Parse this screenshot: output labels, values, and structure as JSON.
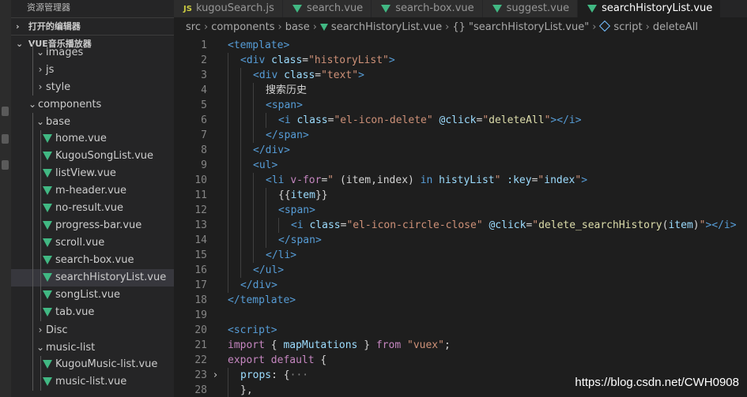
{
  "sidebar": {
    "title": "资源管理器",
    "open_editors_label": "打开的编辑器",
    "project_label": "VUE音乐播放器",
    "tree": [
      {
        "label": "images",
        "kind": "folder",
        "expanded": true,
        "depth": 2
      },
      {
        "label": "js",
        "kind": "folder",
        "expanded": false,
        "depth": 2
      },
      {
        "label": "style",
        "kind": "folder",
        "expanded": false,
        "depth": 2
      },
      {
        "label": "components",
        "kind": "folder",
        "expanded": true,
        "depth": 1
      },
      {
        "label": "base",
        "kind": "folder",
        "expanded": true,
        "depth": 2
      },
      {
        "label": "home.vue",
        "kind": "vue",
        "depth": 3
      },
      {
        "label": "KugouSongList.vue",
        "kind": "vue",
        "depth": 3
      },
      {
        "label": "listView.vue",
        "kind": "vue",
        "depth": 3
      },
      {
        "label": "m-header.vue",
        "kind": "vue",
        "depth": 3
      },
      {
        "label": "no-result.vue",
        "kind": "vue",
        "depth": 3
      },
      {
        "label": "progress-bar.vue",
        "kind": "vue",
        "depth": 3
      },
      {
        "label": "scroll.vue",
        "kind": "vue",
        "depth": 3
      },
      {
        "label": "search-box.vue",
        "kind": "vue",
        "depth": 3
      },
      {
        "label": "searchHistoryList.vue",
        "kind": "vue",
        "depth": 3,
        "selected": true
      },
      {
        "label": "songList.vue",
        "kind": "vue",
        "depth": 3
      },
      {
        "label": "tab.vue",
        "kind": "vue",
        "depth": 3
      },
      {
        "label": "Disc",
        "kind": "folder",
        "expanded": false,
        "depth": 2
      },
      {
        "label": "music-list",
        "kind": "folder",
        "expanded": true,
        "depth": 2
      },
      {
        "label": "KugouMusic-list.vue",
        "kind": "vue",
        "depth": 3
      },
      {
        "label": "music-list.vue",
        "kind": "vue",
        "depth": 3
      }
    ]
  },
  "tabs": [
    {
      "label": "kugouSearch.js",
      "icon": "js",
      "active": false
    },
    {
      "label": "search.vue",
      "icon": "vue",
      "active": false
    },
    {
      "label": "search-box.vue",
      "icon": "vue",
      "active": false
    },
    {
      "label": "suggest.vue",
      "icon": "vue",
      "active": false
    },
    {
      "label": "searchHistoryList.vue",
      "icon": "vue",
      "active": true
    }
  ],
  "breadcrumb": [
    "src",
    "components",
    "base",
    "searchHistoryList.vue",
    "{} \"searchHistoryList.vue\"",
    "script",
    "deleteAll"
  ],
  "code": [
    {
      "n": "1",
      "indent": 0,
      "tokens": [
        [
          "tag",
          "<template>"
        ]
      ]
    },
    {
      "n": "2",
      "indent": 1,
      "tokens": [
        [
          "tag",
          "<div "
        ],
        [
          "attr",
          "class"
        ],
        [
          "txt",
          "="
        ],
        [
          "str",
          "\"historyList\""
        ],
        [
          "tag",
          ">"
        ]
      ]
    },
    {
      "n": "3",
      "indent": 2,
      "tokens": [
        [
          "tag",
          "<div "
        ],
        [
          "attr",
          "class"
        ],
        [
          "txt",
          "="
        ],
        [
          "str",
          "\"text\""
        ],
        [
          "tag",
          ">"
        ]
      ]
    },
    {
      "n": "4",
      "indent": 3,
      "tokens": [
        [
          "cjk",
          "搜索历史"
        ]
      ]
    },
    {
      "n": "5",
      "indent": 3,
      "tokens": [
        [
          "tag",
          "<span>"
        ]
      ]
    },
    {
      "n": "6",
      "indent": 4,
      "tokens": [
        [
          "tag",
          "<i "
        ],
        [
          "attr",
          "class"
        ],
        [
          "txt",
          "="
        ],
        [
          "str",
          "\"el-icon-delete\""
        ],
        [
          "txt",
          " "
        ],
        [
          "attr",
          "@click"
        ],
        [
          "txt",
          "="
        ],
        [
          "str",
          "\""
        ],
        [
          "fn",
          "deleteAll"
        ],
        [
          "str",
          "\""
        ],
        [
          "tag",
          "></i>"
        ]
      ]
    },
    {
      "n": "7",
      "indent": 3,
      "tokens": [
        [
          "tag",
          "</span>"
        ]
      ]
    },
    {
      "n": "8",
      "indent": 2,
      "tokens": [
        [
          "tag",
          "</div>"
        ]
      ]
    },
    {
      "n": "9",
      "indent": 2,
      "tokens": [
        [
          "tag",
          "<ul>"
        ]
      ]
    },
    {
      "n": "10",
      "indent": 3,
      "tokens": [
        [
          "tag",
          "<li "
        ],
        [
          "kw2",
          "v-for"
        ],
        [
          "txt",
          "="
        ],
        [
          "str",
          "\" "
        ],
        [
          "txt",
          "(item,index) "
        ],
        [
          "kw",
          "in"
        ],
        [
          "txt",
          " "
        ],
        [
          "var",
          "histyList"
        ],
        [
          "str",
          "\""
        ],
        [
          "txt",
          " "
        ],
        [
          "attr",
          ":key"
        ],
        [
          "txt",
          "="
        ],
        [
          "str",
          "\""
        ],
        [
          "var",
          "index"
        ],
        [
          "str",
          "\""
        ],
        [
          "tag",
          ">"
        ]
      ]
    },
    {
      "n": "11",
      "indent": 4,
      "tokens": [
        [
          "txt",
          "{{"
        ],
        [
          "var",
          "item"
        ],
        [
          "txt",
          "}}"
        ]
      ]
    },
    {
      "n": "12",
      "indent": 4,
      "tokens": [
        [
          "tag",
          "<span>"
        ]
      ]
    },
    {
      "n": "13",
      "indent": 5,
      "tokens": [
        [
          "tag",
          "<i "
        ],
        [
          "attr",
          "class"
        ],
        [
          "txt",
          "="
        ],
        [
          "str",
          "\"el-icon-circle-close\""
        ],
        [
          "txt",
          " "
        ],
        [
          "attr",
          "@click"
        ],
        [
          "txt",
          "="
        ],
        [
          "str",
          "\""
        ],
        [
          "fn",
          "delete_searchHistory"
        ],
        [
          "txt",
          "("
        ],
        [
          "var",
          "item"
        ],
        [
          "txt",
          ")"
        ],
        [
          "str",
          "\""
        ],
        [
          "tag",
          "></i>"
        ]
      ]
    },
    {
      "n": "14",
      "indent": 4,
      "tokens": [
        [
          "tag",
          "</span>"
        ]
      ]
    },
    {
      "n": "15",
      "indent": 3,
      "tokens": [
        [
          "tag",
          "</li>"
        ]
      ]
    },
    {
      "n": "16",
      "indent": 2,
      "tokens": [
        [
          "tag",
          "</ul>"
        ]
      ]
    },
    {
      "n": "17",
      "indent": 1,
      "tokens": [
        [
          "tag",
          "</div>"
        ]
      ]
    },
    {
      "n": "18",
      "indent": 0,
      "tokens": [
        [
          "tag",
          "</template>"
        ]
      ]
    },
    {
      "n": "19",
      "indent": 0,
      "tokens": []
    },
    {
      "n": "20",
      "indent": 0,
      "tokens": [
        [
          "tag",
          "<script>"
        ]
      ]
    },
    {
      "n": "21",
      "indent": 0,
      "tokens": [
        [
          "kw2",
          "import"
        ],
        [
          "txt",
          " { "
        ],
        [
          "var",
          "mapMutations"
        ],
        [
          "txt",
          " } "
        ],
        [
          "kw2",
          "from"
        ],
        [
          "txt",
          " "
        ],
        [
          "str",
          "\"vuex\""
        ],
        [
          "txt",
          ";"
        ]
      ]
    },
    {
      "n": "22",
      "indent": 0,
      "tokens": [
        [
          "kw2",
          "export"
        ],
        [
          "txt",
          " "
        ],
        [
          "kw2",
          "default"
        ],
        [
          "txt",
          " {"
        ]
      ]
    },
    {
      "n": "23",
      "indent": 1,
      "fold": true,
      "tokens": [
        [
          "var",
          "props"
        ],
        [
          "txt",
          ": {"
        ],
        [
          "pun",
          "···"
        ]
      ]
    },
    {
      "n": "28",
      "indent": 1,
      "tokens": [
        [
          "txt",
          "},"
        ]
      ]
    }
  ],
  "watermark": "https://blog.csdn.net/CWH0908",
  "colors": {
    "vue_green": "#41b883",
    "js_yellow": "#cbcb41",
    "editor_bg": "#1e1e1e",
    "sidebar_bg": "#252526"
  }
}
